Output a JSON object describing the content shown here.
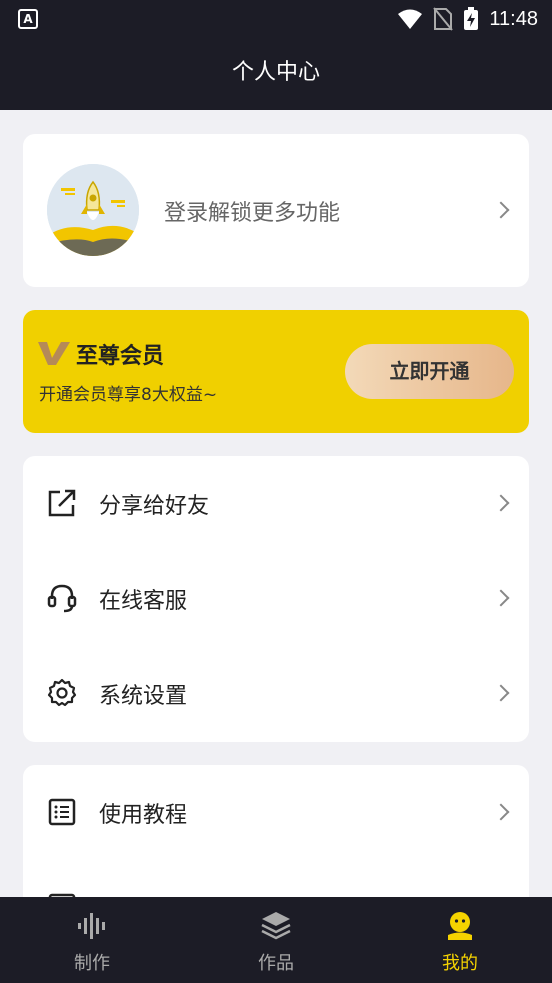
{
  "status_bar": {
    "app_icon_letter": "A",
    "time": "11:48"
  },
  "header": {
    "title": "个人中心"
  },
  "login": {
    "text": "登录解锁更多功能"
  },
  "vip": {
    "title": "至尊会员",
    "subtitle": "开通会员尊享8大权益~",
    "button_label": "立即开通"
  },
  "menu": [
    {
      "label": "分享给好友",
      "icon": "share-icon"
    },
    {
      "label": "在线客服",
      "icon": "headset-icon"
    },
    {
      "label": "系统设置",
      "icon": "gear-icon"
    }
  ],
  "menu2": [
    {
      "label": "使用教程",
      "icon": "list-icon"
    }
  ],
  "tabs": [
    {
      "label": "制作",
      "icon": "waveform-icon",
      "active": false
    },
    {
      "label": "作品",
      "icon": "layers-icon",
      "active": false
    },
    {
      "label": "我的",
      "icon": "smiley-icon",
      "active": true
    }
  ],
  "colors": {
    "accent": "#f0d000",
    "dark_bg": "#1c1c26",
    "page_bg": "#f0f0f4"
  }
}
